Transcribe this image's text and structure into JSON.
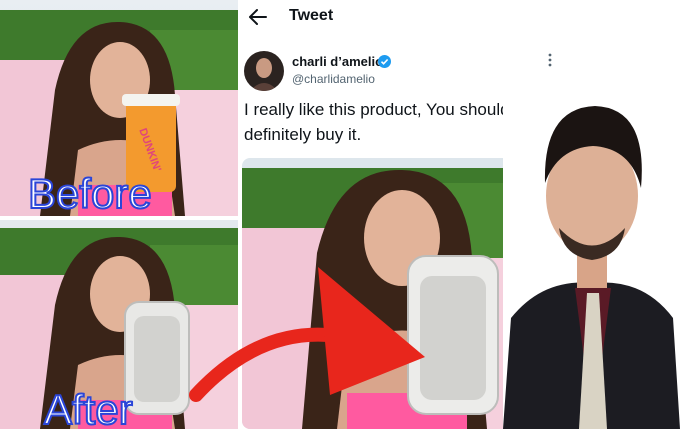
{
  "header": {
    "title": "Tweet"
  },
  "tweet": {
    "display_name": "charli d’amelio",
    "handle": "@charlidamelio",
    "text": "I really like this product, You should definitely buy it."
  },
  "captions": {
    "before": "Before",
    "after": "After"
  },
  "product_text": "DUNKIN'",
  "icons": {
    "back": "arrow-left-icon",
    "verified": "verified-badge-icon",
    "more": "more-vertical-icon"
  },
  "colors": {
    "caption_outline": "#2a45d8",
    "arrow": "#e8261c",
    "verified": "#1d9bf0",
    "pink_top": "#ff5aa0"
  }
}
